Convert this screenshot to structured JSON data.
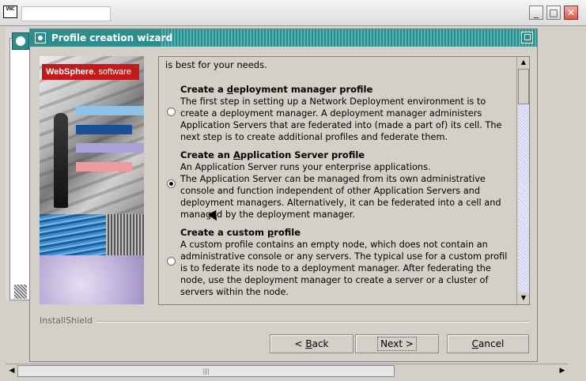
{
  "outer_window": {
    "icon_text": "VNC",
    "title": "",
    "btn_min": "_",
    "btn_max": "□",
    "btn_close": "✕"
  },
  "dialog": {
    "title": "Profile creation wizard"
  },
  "banner": {
    "brand": "WebSphere",
    "brand_suffix": "software",
    "bar_colors": [
      "#8fc0e8",
      "#1a4f9a",
      "#a7a3d9",
      "#ef9b9b"
    ]
  },
  "content": {
    "cut_line": "is best for your needs.",
    "options": [
      {
        "title_pre": "Create a ",
        "title_ul": "d",
        "title_post": "eployment manager profile",
        "desc": [
          "The first step in setting up a Network Deployment environment is to",
          "create a deployment manager. A deployment manager administers",
          "Application Servers that are federated into (made a part of) its cell. The",
          "next step is to create additional profiles and federate them."
        ],
        "selected": false
      },
      {
        "title_pre": "Create an ",
        "title_ul": "A",
        "title_post": "pplication Server profile",
        "desc": [
          "An Application Server runs your enterprise applications.",
          "The Application Server can be managed from its own administrative",
          "console and function independent of other Application Servers and",
          "deployment managers. Alternatively, it can be federated into a cell and",
          "managed by the deployment manager."
        ],
        "selected": true
      },
      {
        "title_pre": "Create a custom ",
        "title_ul": "p",
        "title_post": "rofile",
        "desc": [
          "A custom profile contains an empty node, which does not contain an",
          "administrative console or any servers. The typical use for a custom profil",
          "is to federate its node to a deployment manager. After federating the",
          "node, use the deployment manager to create a server or a cluster of",
          "servers within the node."
        ],
        "selected": false
      }
    ]
  },
  "footer": {
    "installshield": "InstallShield",
    "back_pre": "< ",
    "back_ul": "B",
    "back_post": "ack",
    "next_pre": "Next ",
    "next_post": ">",
    "cancel_ul": "C",
    "cancel_post": "ancel"
  },
  "hscroll": {
    "grip": "|||"
  },
  "colors": {
    "title_bar": "#2f8c8c",
    "brand_red": "#c41a1a"
  }
}
